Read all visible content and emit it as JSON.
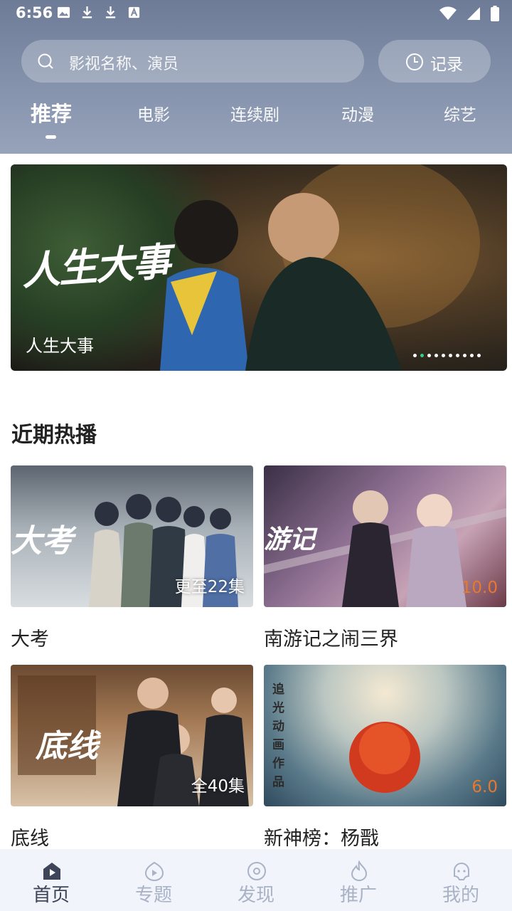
{
  "status_bar": {
    "time": "6:56"
  },
  "search": {
    "placeholder": "影视名称、演员"
  },
  "history": {
    "label": "记录"
  },
  "tabs": [
    {
      "label": "推荐",
      "active": true
    },
    {
      "label": "电影"
    },
    {
      "label": "连续剧"
    },
    {
      "label": "动漫"
    },
    {
      "label": "综艺"
    }
  ],
  "banner": {
    "logo_text": "人生大事",
    "title": "人生大事",
    "slide_count": 10,
    "active_slide": 2
  },
  "section": {
    "title": "近期热播"
  },
  "cards": [
    {
      "title": "大考",
      "badge": "更至22集",
      "poster_text": "大考"
    },
    {
      "title": "南游记之闹三界",
      "score": "10.0",
      "poster_text": "游记"
    },
    {
      "title": "底线",
      "badge": "全40集",
      "poster_text": "底线"
    },
    {
      "title": "新神榜：杨戬",
      "score": "6.0",
      "poster_text": "追光动画作品"
    }
  ],
  "bottom_nav": [
    {
      "label": "首页",
      "icon": "home-play-icon",
      "active": true
    },
    {
      "label": "专题",
      "icon": "topic-play-icon"
    },
    {
      "label": "发现",
      "icon": "discover-disc-icon"
    },
    {
      "label": "推广",
      "icon": "flame-icon"
    },
    {
      "label": "我的",
      "icon": "profile-face-icon"
    }
  ],
  "colors": {
    "header": "#7d89a4",
    "accent_dot": "#2fd18f",
    "score": "#e7782f",
    "nav_inactive": "#aab2c6",
    "nav_active": "#3e4559"
  }
}
